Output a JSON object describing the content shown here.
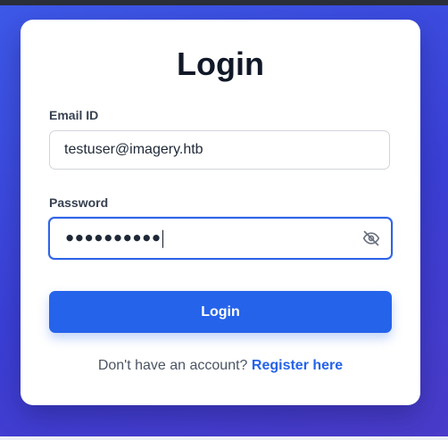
{
  "login_form": {
    "title": "Login",
    "email": {
      "label": "Email ID",
      "value": "testuser@imagery.htb"
    },
    "password": {
      "label": "Password",
      "masked_value": "●●●●●●●●●●"
    },
    "submit_label": "Login",
    "register": {
      "prompt": "Don't have an account?",
      "link_label": "Register here"
    }
  },
  "icons": {
    "password_visibility": "eye-slash-icon"
  },
  "colors": {
    "accent": "#2563eb",
    "background_gradient_start": "#3d59e8",
    "background_gradient_end": "#4a3bc9",
    "card": "#ffffff",
    "title_text": "#111827"
  }
}
